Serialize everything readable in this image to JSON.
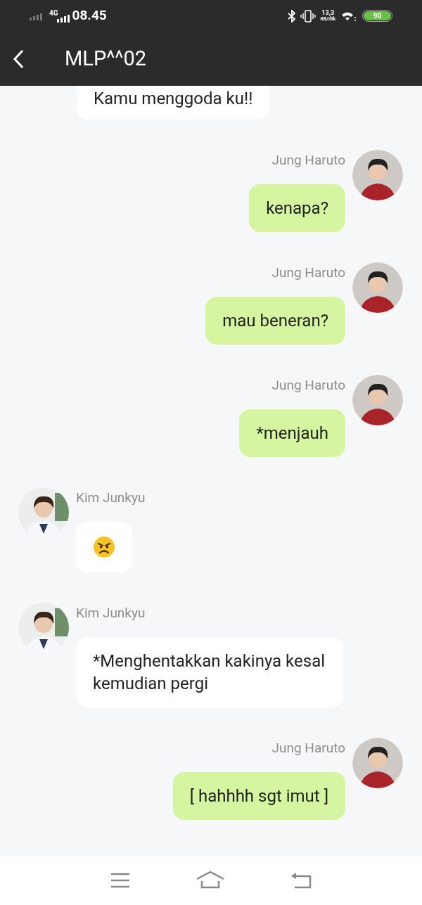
{
  "status_bar": {
    "network": "4G",
    "time": "08.45",
    "speed_value": "13,3",
    "speed_unit": "KB/dtk",
    "battery": "90"
  },
  "header": {
    "title": "MLP^^02"
  },
  "messages": [
    {
      "kind": "clipped",
      "text": "Kamu menggoda ku!!"
    },
    {
      "kind": "sent",
      "sender": "Jung Haruto",
      "text": "kenapa?"
    },
    {
      "kind": "sent",
      "sender": "Jung Haruto",
      "text": "mau beneran?"
    },
    {
      "kind": "sent",
      "sender": "Jung Haruto",
      "text": "*menjauh"
    },
    {
      "kind": "reaction",
      "sender": "Kim Junkyu"
    },
    {
      "kind": "received",
      "sender": "Kim Junkyu",
      "text": "*Menghentakkan kakinya kesal kemudian pergi"
    },
    {
      "kind": "sent",
      "sender": "Jung Haruto",
      "text": "[ hahhhh sgt imut ]"
    }
  ]
}
